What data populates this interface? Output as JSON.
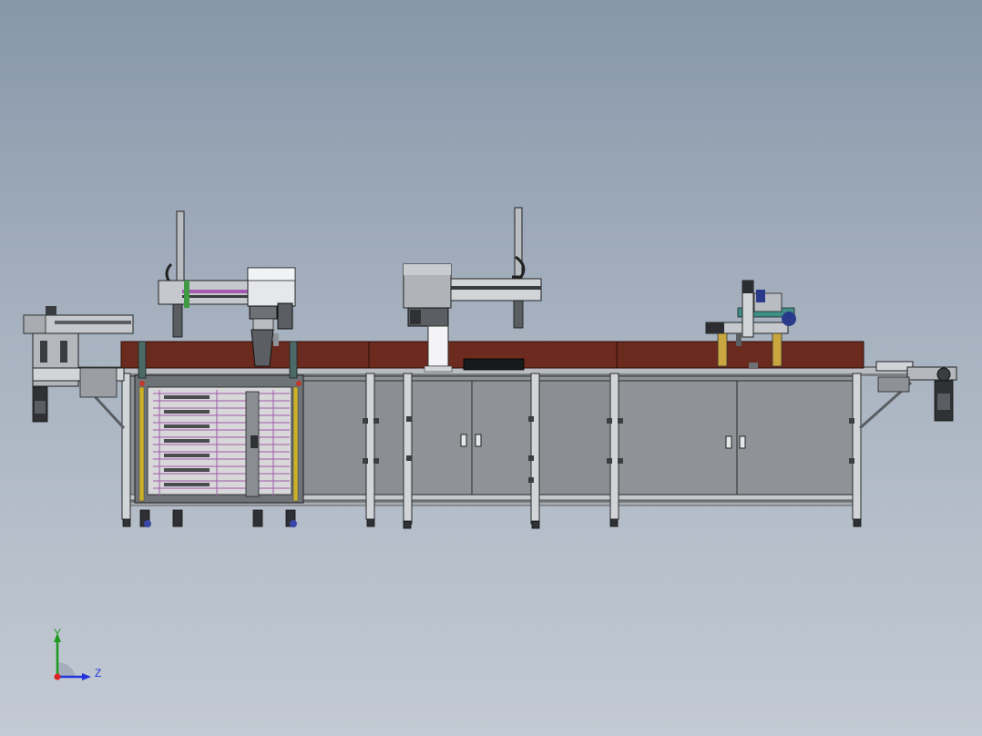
{
  "triad": {
    "y_label": "Y",
    "z_label": "Z",
    "colors": {
      "y": "#1c9a1c",
      "z": "#2233dd",
      "x": "#dd2222"
    }
  },
  "colors": {
    "background_top": "#8797a9",
    "background_bottom": "#c3cad3",
    "frame": "#c9ccd0",
    "cabinet": "#8e9196",
    "conveyor_cover": "#6b2a1e",
    "yellow_supports": "#c9a640"
  }
}
